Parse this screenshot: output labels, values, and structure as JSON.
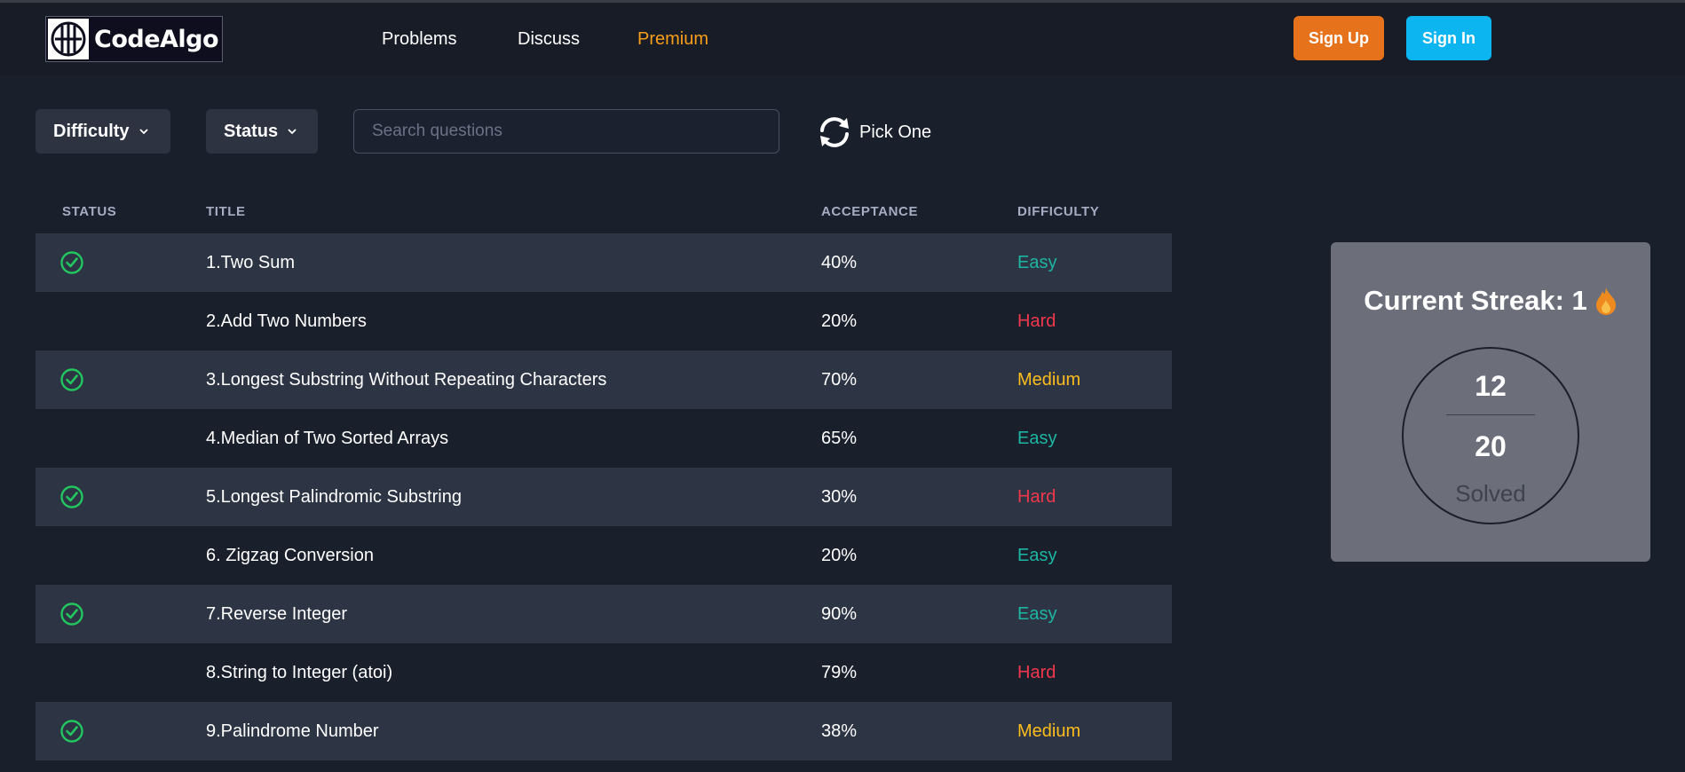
{
  "brand": {
    "name": "CodeAlgo"
  },
  "nav": {
    "links": [
      "Problems",
      "Discuss",
      "Premium"
    ],
    "signup": "Sign Up",
    "signin": "Sign In"
  },
  "filters": {
    "difficulty": "Difficulty",
    "status": "Status",
    "search_placeholder": "Search questions",
    "pick_one": "Pick One"
  },
  "table": {
    "headers": [
      "STATUS",
      "TITLE",
      "ACCEPTANCE",
      "DIFFICULTY"
    ],
    "rows": [
      {
        "solved": true,
        "title": "1.Two Sum",
        "acceptance": "40%",
        "difficulty": "Easy"
      },
      {
        "solved": false,
        "title": "2.Add Two Numbers",
        "acceptance": "20%",
        "difficulty": "Hard"
      },
      {
        "solved": true,
        "title": "3.Longest Substring Without Repeating Characters",
        "acceptance": "70%",
        "difficulty": "Medium"
      },
      {
        "solved": false,
        "title": "4.Median of Two Sorted Arrays",
        "acceptance": "65%",
        "difficulty": "Easy"
      },
      {
        "solved": true,
        "title": "5.Longest Palindromic Substring",
        "acceptance": "30%",
        "difficulty": "Hard"
      },
      {
        "solved": false,
        "title": "6. Zigzag Conversion",
        "acceptance": "20%",
        "difficulty": "Easy"
      },
      {
        "solved": true,
        "title": "7.Reverse Integer",
        "acceptance": "90%",
        "difficulty": "Easy"
      },
      {
        "solved": false,
        "title": "8.String to Integer (atoi)",
        "acceptance": "79%",
        "difficulty": "Hard"
      },
      {
        "solved": true,
        "title": "9.Palindrome Number",
        "acceptance": "38%",
        "difficulty": "Medium"
      }
    ]
  },
  "streak": {
    "title": "Current Streak: 1",
    "solved": "12",
    "total": "20",
    "label": "Solved"
  },
  "colors": {
    "easy": "#1db6a3",
    "hard": "#f0384c",
    "medium": "#fdbd1e",
    "signup": "#e6731c",
    "signin": "#0cb5f0",
    "premium": "#f89f1b",
    "check": "#22c55e"
  },
  "icons": {
    "logo": "circle-grid-logo-icon",
    "dropdown": "chevron-down-icon",
    "pick_one": "refresh-icon",
    "solved": "check-circle-icon",
    "streak": "flame-icon"
  }
}
